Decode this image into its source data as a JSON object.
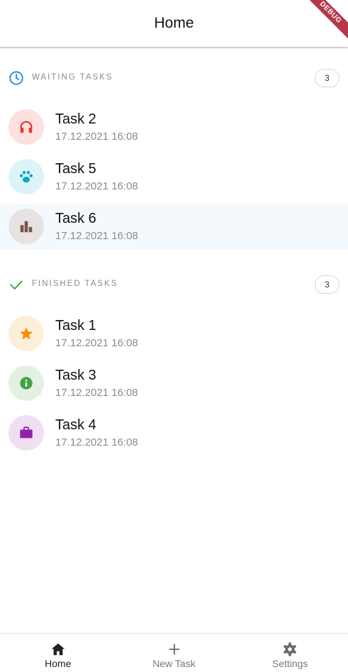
{
  "appbar": {
    "title": "Home",
    "debug_banner": "DEBUG"
  },
  "waiting": {
    "title": "WAITING TASKS",
    "count": "3",
    "icon": "clock-icon",
    "tasks": [
      {
        "title": "Task 2",
        "date": "17.12.2021 16:08",
        "icon": "headphones-icon",
        "icon_color": "#e53935",
        "avatar_bg": "#fde0e0"
      },
      {
        "title": "Task 5",
        "date": "17.12.2021 16:08",
        "icon": "paw-icon",
        "icon_color": "#00acc1",
        "avatar_bg": "#dcf4f8"
      },
      {
        "title": "Task 6",
        "date": "17.12.2021 16:08",
        "icon": "bar-chart-icon",
        "icon_color": "#795548",
        "avatar_bg": "#e6e3e2",
        "selected": true
      }
    ]
  },
  "finished": {
    "title": "FINISHED TASKS",
    "count": "3",
    "icon": "check-icon",
    "tasks": [
      {
        "title": "Task 1",
        "date": "17.12.2021 16:08",
        "icon": "star-icon",
        "icon_color": "#fb8c00",
        "avatar_bg": "#fdeed8"
      },
      {
        "title": "Task 3",
        "date": "17.12.2021 16:08",
        "icon": "info-icon",
        "icon_color": "#43a047",
        "avatar_bg": "#e3f1e3"
      },
      {
        "title": "Task 4",
        "date": "17.12.2021 16:08",
        "icon": "briefcase-icon",
        "icon_color": "#8e24aa",
        "avatar_bg": "#f0dff3"
      }
    ]
  },
  "nav": {
    "items": [
      {
        "label": "Home",
        "icon": "home-icon",
        "active": true
      },
      {
        "label": "New Task",
        "icon": "plus-icon",
        "active": false
      },
      {
        "label": "Settings",
        "icon": "gear-icon",
        "active": false
      }
    ]
  },
  "colors": {
    "accent": "#1e88e5",
    "check": "#43a047",
    "nav_inactive": "#7a7a7a"
  }
}
